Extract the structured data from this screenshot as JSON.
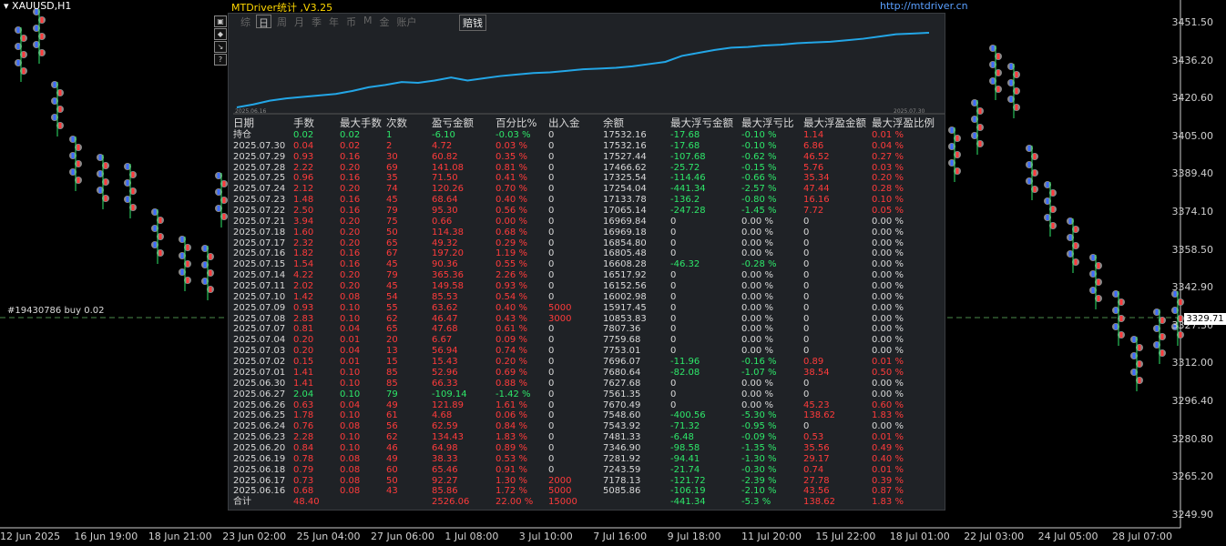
{
  "symbol": "XAUUSD,H1",
  "panel": {
    "title": "MTDriver统计 ,V3.25",
    "url": "http://mtdriver.cn",
    "tabs": [
      "综",
      "日",
      "周",
      "月",
      "季",
      "年",
      "币",
      "M",
      "金",
      "账户"
    ],
    "active_tab": "日",
    "right_tab": "赔钱",
    "chart_start": "2025.06.16",
    "chart_end": "2025.07.30",
    "equity_series": [
      0.0,
      0.04,
      0.09,
      0.12,
      0.14,
      0.16,
      0.18,
      0.22,
      0.27,
      0.3,
      0.34,
      0.33,
      0.36,
      0.4,
      0.36,
      0.39,
      0.42,
      0.44,
      0.46,
      0.47,
      0.49,
      0.51,
      0.52,
      0.53,
      0.55,
      0.58,
      0.61,
      0.69,
      0.73,
      0.77,
      0.8,
      0.81,
      0.83,
      0.84,
      0.86,
      0.87,
      0.88,
      0.9,
      0.92,
      0.95,
      0.98,
      0.99,
      1.0
    ],
    "equity_color": "#23a6e6"
  },
  "table": {
    "headers": [
      "日期",
      "手数",
      "最大手数",
      "次数",
      "盈亏金额",
      "百分比%",
      "出入金",
      "余额",
      "最大浮亏金额",
      "最大浮亏比",
      "最大浮盈金额",
      "最大浮盈比例"
    ],
    "rows": [
      {
        "d": "持仓",
        "lots": "0.02",
        "max": "0.02",
        "cnt": "1",
        "pl": "-6.10",
        "pct": "-0.03 %",
        "io": "0",
        "bal": "17532.16",
        "fl": "-17.68",
        "flp": "-0.10 %",
        "fp": "1.14",
        "fpp": "0.01 %",
        "c": "g"
      },
      {
        "d": "2025.07.30",
        "lots": "0.04",
        "max": "0.02",
        "cnt": "2",
        "pl": "4.72",
        "pct": "0.03 %",
        "io": "0",
        "bal": "17532.16",
        "fl": "-17.68",
        "flp": "-0.10 %",
        "fp": "6.86",
        "fpp": "0.04 %",
        "c": "r"
      },
      {
        "d": "2025.07.29",
        "lots": "0.93",
        "max": "0.16",
        "cnt": "30",
        "pl": "60.82",
        "pct": "0.35 %",
        "io": "0",
        "bal": "17527.44",
        "fl": "-107.68",
        "flp": "-0.62 %",
        "fp": "46.52",
        "fpp": "0.27 %",
        "c": "r"
      },
      {
        "d": "2025.07.28",
        "lots": "2.22",
        "max": "0.20",
        "cnt": "69",
        "pl": "141.08",
        "pct": "0.81 %",
        "io": "0",
        "bal": "17466.62",
        "fl": "-25.72",
        "flp": "-0.15 %",
        "fp": "5.76",
        "fpp": "0.03 %",
        "c": "r"
      },
      {
        "d": "2025.07.25",
        "lots": "0.96",
        "max": "0.16",
        "cnt": "35",
        "pl": "71.50",
        "pct": "0.41 %",
        "io": "0",
        "bal": "17325.54",
        "fl": "-114.46",
        "flp": "-0.66 %",
        "fp": "35.34",
        "fpp": "0.20 %",
        "c": "r"
      },
      {
        "d": "2025.07.24",
        "lots": "2.12",
        "max": "0.20",
        "cnt": "74",
        "pl": "120.26",
        "pct": "0.70 %",
        "io": "0",
        "bal": "17254.04",
        "fl": "-441.34",
        "flp": "-2.57 %",
        "fp": "47.44",
        "fpp": "0.28 %",
        "c": "r"
      },
      {
        "d": "2025.07.23",
        "lots": "1.48",
        "max": "0.16",
        "cnt": "45",
        "pl": "68.64",
        "pct": "0.40 %",
        "io": "0",
        "bal": "17133.78",
        "fl": "-136.2",
        "flp": "-0.80 %",
        "fp": "16.16",
        "fpp": "0.10 %",
        "c": "r"
      },
      {
        "d": "2025.07.22",
        "lots": "2.50",
        "max": "0.16",
        "cnt": "79",
        "pl": "95.30",
        "pct": "0.56 %",
        "io": "0",
        "bal": "17065.14",
        "fl": "-247.28",
        "flp": "-1.45 %",
        "fp": "7.72",
        "fpp": "0.05 %",
        "c": "r"
      },
      {
        "d": "2025.07.21",
        "lots": "3.94",
        "max": "0.20",
        "cnt": "75",
        "pl": "0.66",
        "pct": "0.00 %",
        "io": "0",
        "bal": "16969.84",
        "fl": "0",
        "flp": "0.00 %",
        "fp": "0",
        "fpp": "0.00 %",
        "c": "r"
      },
      {
        "d": "2025.07.18",
        "lots": "1.60",
        "max": "0.20",
        "cnt": "50",
        "pl": "114.38",
        "pct": "0.68 %",
        "io": "0",
        "bal": "16969.18",
        "fl": "0",
        "flp": "0.00 %",
        "fp": "0",
        "fpp": "0.00 %",
        "c": "r"
      },
      {
        "d": "2025.07.17",
        "lots": "2.32",
        "max": "0.20",
        "cnt": "65",
        "pl": "49.32",
        "pct": "0.29 %",
        "io": "0",
        "bal": "16854.80",
        "fl": "0",
        "flp": "0.00 %",
        "fp": "0",
        "fpp": "0.00 %",
        "c": "r"
      },
      {
        "d": "2025.07.16",
        "lots": "1.82",
        "max": "0.16",
        "cnt": "67",
        "pl": "197.20",
        "pct": "1.19 %",
        "io": "0",
        "bal": "16805.48",
        "fl": "0",
        "flp": "0.00 %",
        "fp": "0",
        "fpp": "0.00 %",
        "c": "r"
      },
      {
        "d": "2025.07.15",
        "lots": "1.54",
        "max": "0.16",
        "cnt": "45",
        "pl": "90.36",
        "pct": "0.55 %",
        "io": "0",
        "bal": "16608.28",
        "fl": "-46.32",
        "flp": "-0.28 %",
        "fp": "0",
        "fpp": "0.00 %",
        "c": "r"
      },
      {
        "d": "2025.07.14",
        "lots": "4.22",
        "max": "0.20",
        "cnt": "79",
        "pl": "365.36",
        "pct": "2.26 %",
        "io": "0",
        "bal": "16517.92",
        "fl": "0",
        "flp": "0.00 %",
        "fp": "0",
        "fpp": "0.00 %",
        "c": "r"
      },
      {
        "d": "2025.07.11",
        "lots": "2.02",
        "max": "0.20",
        "cnt": "45",
        "pl": "149.58",
        "pct": "0.93 %",
        "io": "0",
        "bal": "16152.56",
        "fl": "0",
        "flp": "0.00 %",
        "fp": "0",
        "fpp": "0.00 %",
        "c": "r"
      },
      {
        "d": "2025.07.10",
        "lots": "1.42",
        "max": "0.08",
        "cnt": "54",
        "pl": "85.53",
        "pct": "0.54 %",
        "io": "0",
        "bal": "16002.98",
        "fl": "0",
        "flp": "0.00 %",
        "fp": "0",
        "fpp": "0.00 %",
        "c": "r"
      },
      {
        "d": "2025.07.09",
        "lots": "0.93",
        "max": "0.10",
        "cnt": "55",
        "pl": "63.62",
        "pct": "0.40 %",
        "io": "5000",
        "bal": "15917.45",
        "fl": "0",
        "flp": "0.00 %",
        "fp": "0",
        "fpp": "0.00 %",
        "c": "r"
      },
      {
        "d": "2025.07.08",
        "lots": "2.83",
        "max": "0.10",
        "cnt": "62",
        "pl": "46.47",
        "pct": "0.43 %",
        "io": "3000",
        "bal": "10853.83",
        "fl": "0",
        "flp": "0.00 %",
        "fp": "0",
        "fpp": "0.00 %",
        "c": "r"
      },
      {
        "d": "2025.07.07",
        "lots": "0.81",
        "max": "0.04",
        "cnt": "65",
        "pl": "47.68",
        "pct": "0.61 %",
        "io": "0",
        "bal": "7807.36",
        "fl": "0",
        "flp": "0.00 %",
        "fp": "0",
        "fpp": "0.00 %",
        "c": "r"
      },
      {
        "d": "2025.07.04",
        "lots": "0.20",
        "max": "0.01",
        "cnt": "20",
        "pl": "6.67",
        "pct": "0.09 %",
        "io": "0",
        "bal": "7759.68",
        "fl": "0",
        "flp": "0.00 %",
        "fp": "0",
        "fpp": "0.00 %",
        "c": "r"
      },
      {
        "d": "2025.07.03",
        "lots": "0.20",
        "max": "0.04",
        "cnt": "13",
        "pl": "56.94",
        "pct": "0.74 %",
        "io": "0",
        "bal": "7753.01",
        "fl": "0",
        "flp": "0.00 %",
        "fp": "0",
        "fpp": "0.00 %",
        "c": "r"
      },
      {
        "d": "2025.07.02",
        "lots": "0.15",
        "max": "0.01",
        "cnt": "15",
        "pl": "15.43",
        "pct": "0.20 %",
        "io": "0",
        "bal": "7696.07",
        "fl": "-11.96",
        "flp": "-0.16 %",
        "fp": "0.89",
        "fpp": "0.01 %",
        "c": "r"
      },
      {
        "d": "2025.07.01",
        "lots": "1.41",
        "max": "0.10",
        "cnt": "85",
        "pl": "52.96",
        "pct": "0.69 %",
        "io": "0",
        "bal": "7680.64",
        "fl": "-82.08",
        "flp": "-1.07 %",
        "fp": "38.54",
        "fpp": "0.50 %",
        "c": "r"
      },
      {
        "d": "2025.06.30",
        "lots": "1.41",
        "max": "0.10",
        "cnt": "85",
        "pl": "66.33",
        "pct": "0.88 %",
        "io": "0",
        "bal": "7627.68",
        "fl": "0",
        "flp": "0.00 %",
        "fp": "0",
        "fpp": "0.00 %",
        "c": "r"
      },
      {
        "d": "2025.06.27",
        "lots": "2.04",
        "max": "0.10",
        "cnt": "79",
        "pl": "-109.14",
        "pct": "-1.42 %",
        "io": "0",
        "bal": "7561.35",
        "fl": "0",
        "flp": "0.00 %",
        "fp": "0",
        "fpp": "0.00 %",
        "c": "g"
      },
      {
        "d": "2025.06.26",
        "lots": "0.63",
        "max": "0.04",
        "cnt": "49",
        "pl": "121.89",
        "pct": "1.61 %",
        "io": "0",
        "bal": "7670.49",
        "fl": "0",
        "flp": "0.00 %",
        "fp": "45.23",
        "fpp": "0.60 %",
        "c": "r"
      },
      {
        "d": "2025.06.25",
        "lots": "1.78",
        "max": "0.10",
        "cnt": "61",
        "pl": "4.68",
        "pct": "0.06 %",
        "io": "0",
        "bal": "7548.60",
        "fl": "-400.56",
        "flp": "-5.30 %",
        "fp": "138.62",
        "fpp": "1.83 %",
        "c": "r"
      },
      {
        "d": "2025.06.24",
        "lots": "0.76",
        "max": "0.08",
        "cnt": "56",
        "pl": "62.59",
        "pct": "0.84 %",
        "io": "0",
        "bal": "7543.92",
        "fl": "-71.32",
        "flp": "-0.95 %",
        "fp": "0",
        "fpp": "0.00 %",
        "c": "r"
      },
      {
        "d": "2025.06.23",
        "lots": "2.28",
        "max": "0.10",
        "cnt": "62",
        "pl": "134.43",
        "pct": "1.83 %",
        "io": "0",
        "bal": "7481.33",
        "fl": "-6.48",
        "flp": "-0.09 %",
        "fp": "0.53",
        "fpp": "0.01 %",
        "c": "r"
      },
      {
        "d": "2025.06.20",
        "lots": "0.84",
        "max": "0.10",
        "cnt": "46",
        "pl": "64.98",
        "pct": "0.89 %",
        "io": "0",
        "bal": "7346.90",
        "fl": "-98.58",
        "flp": "-1.35 %",
        "fp": "35.56",
        "fpp": "0.49 %",
        "c": "r"
      },
      {
        "d": "2025.06.19",
        "lots": "0.78",
        "max": "0.08",
        "cnt": "49",
        "pl": "38.33",
        "pct": "0.53 %",
        "io": "0",
        "bal": "7281.92",
        "fl": "-94.41",
        "flp": "-1.30 %",
        "fp": "29.17",
        "fpp": "0.40 %",
        "c": "r"
      },
      {
        "d": "2025.06.18",
        "lots": "0.79",
        "max": "0.08",
        "cnt": "60",
        "pl": "65.46",
        "pct": "0.91 %",
        "io": "0",
        "bal": "7243.59",
        "fl": "-21.74",
        "flp": "-0.30 %",
        "fp": "0.74",
        "fpp": "0.01 %",
        "c": "r"
      },
      {
        "d": "2025.06.17",
        "lots": "0.73",
        "max": "0.08",
        "cnt": "50",
        "pl": "92.27",
        "pct": "1.30 %",
        "io": "2000",
        "bal": "7178.13",
        "fl": "-121.72",
        "flp": "-2.39 %",
        "fp": "27.78",
        "fpp": "0.39 %",
        "c": "r"
      },
      {
        "d": "2025.06.16",
        "lots": "0.68",
        "max": "0.08",
        "cnt": "43",
        "pl": "85.86",
        "pct": "1.72 %",
        "io": "5000",
        "bal": "5085.86",
        "fl": "-106.19",
        "flp": "-2.10 %",
        "fp": "43.56",
        "fpp": "0.87 %",
        "c": "r"
      },
      {
        "d": "合计",
        "lots": "48.40",
        "max": "",
        "cnt": "",
        "pl": "2526.06",
        "pct": "22.00 %",
        "io": "15000",
        "bal": "",
        "fl": "-441.34",
        "flp": "-5.3 %",
        "fp": "138.62",
        "fpp": "1.83 %",
        "c": "r"
      }
    ]
  },
  "price_axis": [
    "3451.50",
    "3436.20",
    "3420.60",
    "3405.00",
    "3389.40",
    "3374.10",
    "3358.50",
    "3342.90",
    "3327.30",
    "3312.00",
    "3296.40",
    "3280.80",
    "3265.20",
    "3249.90"
  ],
  "current_price": "3329.71",
  "order_label": "#19430786 buy 0.02",
  "time_axis": [
    "12 Jun 2025",
    "16 Jun 19:00",
    "18 Jun 21:00",
    "23 Jun 02:00",
    "25 Jun 04:00",
    "27 Jun 06:00",
    "1 Jul 08:00",
    "3 Jul 10:00",
    "7 Jul 16:00",
    "9 Jul 18:00",
    "11 Jul 20:00",
    "15 Jul 22:00",
    "18 Jul 01:00",
    "22 Jul 03:00",
    "24 Jul 05:00",
    "28 Jul 07:00"
  ],
  "colors": {
    "bull": "#2ee86a",
    "bear": "#ff3b3b",
    "equity": "#23a6e6",
    "panel_bg": "#1f2226",
    "title": "#ffd700",
    "url": "#5aa0ff"
  }
}
